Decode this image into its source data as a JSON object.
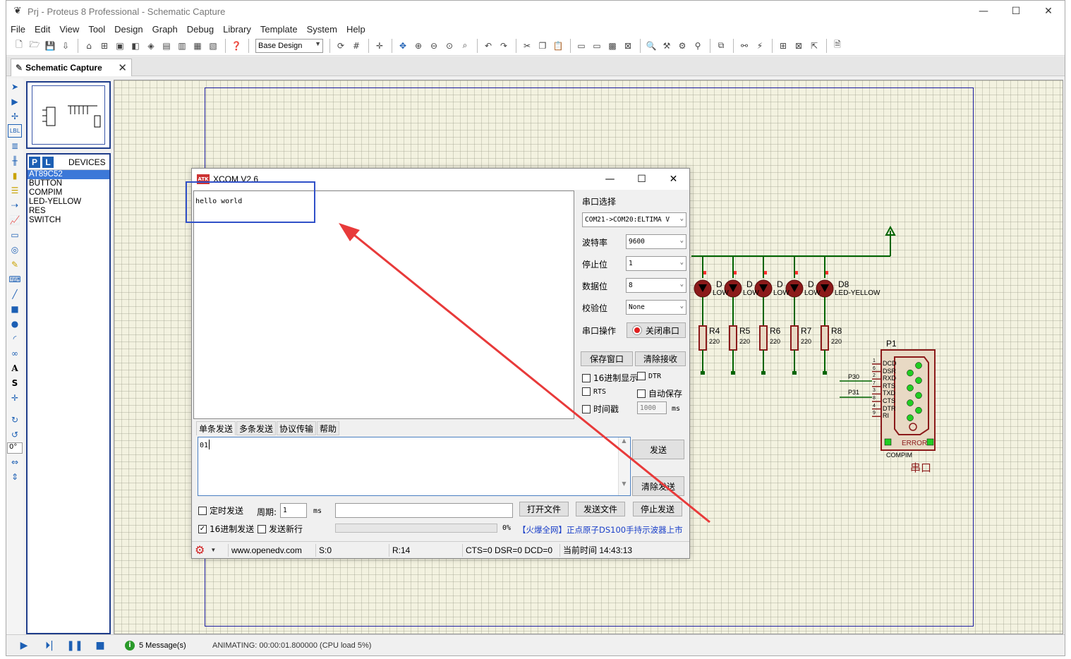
{
  "window": {
    "title": "Prj - Proteus 8 Professional - Schematic Capture",
    "controls": [
      "—",
      "☐",
      "✕"
    ]
  },
  "menu": [
    "File",
    "Edit",
    "View",
    "Tool",
    "Design",
    "Graph",
    "Debug",
    "Library",
    "Template",
    "System",
    "Help"
  ],
  "toolbar": {
    "design_select": "Base Design"
  },
  "tabs": [
    {
      "label": "Schematic Capture"
    }
  ],
  "devices": {
    "header": "DEVICES",
    "p_label": "P",
    "l_label": "L",
    "items": [
      "AT89C52",
      "BUTTON",
      "COMPIM",
      "LED-YELLOW",
      "RES",
      "SWITCH"
    ],
    "selected": "AT89C52"
  },
  "left_tools": {
    "angle": "0°"
  },
  "schematic": {
    "leds": [
      "D",
      "D",
      "D",
      "D",
      "D8"
    ],
    "led_types": [
      "LOW",
      "LOW",
      "LOW",
      "LOW",
      "LED-YELLOW"
    ],
    "resistors": [
      "R4",
      "R5",
      "R6",
      "R7",
      "R8"
    ],
    "res_value": "220",
    "compim": {
      "ref": "P1",
      "pins": [
        "DCD",
        "DSR",
        "RXD",
        "RTS",
        "TXD",
        "CTS",
        "DTR",
        "RI"
      ],
      "pin_nums": [
        "1",
        "6",
        "2",
        "7",
        "3",
        "8",
        "4",
        "9"
      ],
      "error": "ERROR",
      "type": "COMPIM",
      "label": "串口"
    },
    "nets": [
      "P30",
      "P31"
    ]
  },
  "status": {
    "messages": "5 Message(s)",
    "animating": "ANIMATING: 00:00:01.800000 (CPU load 5%)"
  },
  "xcom": {
    "title": "XCOM V2.6",
    "icon_text": "ATK",
    "received": "hello world",
    "port_label": "串口选择",
    "port_value": "COM21->COM20:ELTIMA V",
    "baud_label": "波特率",
    "baud_value": "9600",
    "stop_label": "停止位",
    "stop_value": "1",
    "data_label": "数据位",
    "data_value": "8",
    "parity_label": "校验位",
    "parity_value": "None",
    "op_label": "串口操作",
    "close_port": "关闭串口",
    "save_window": "保存窗口",
    "clear_rx": "清除接收",
    "hex_display": "16进制显示",
    "dtr": "DTR",
    "rts": "RTS",
    "auto_save": "自动保存",
    "timestamp": "时间戳",
    "ts_value": "1000",
    "ts_unit": "ms",
    "tabs": [
      "单条发送",
      "多条发送",
      "协议传输",
      "帮助"
    ],
    "tx_value": "01",
    "send": "发送",
    "clear_send": "清除发送",
    "timed_send": "定时发送",
    "period_label": "周期:",
    "period_value": "1",
    "period_unit": "ms",
    "open_file": "打开文件",
    "send_file": "发送文件",
    "stop_send": "停止发送",
    "hex_send": "16进制发送",
    "send_newline": "发送新行",
    "percent": "0%",
    "ad": "【火爆全网】正点原子DS100手持示波器上市",
    "website": "www.openedv.com",
    "s_count": "S:0",
    "r_count": "R:14",
    "line_status": "CTS=0 DSR=0 DCD=0",
    "current_time": "当前时间 14:43:13"
  },
  "colors": {
    "accent": "#1c5fb4",
    "sheet_border": "#1a1a9e",
    "arrow": "#e83a3a",
    "highlight": "#3050c8",
    "component": "#8b1a1a",
    "wire": "#006400"
  }
}
